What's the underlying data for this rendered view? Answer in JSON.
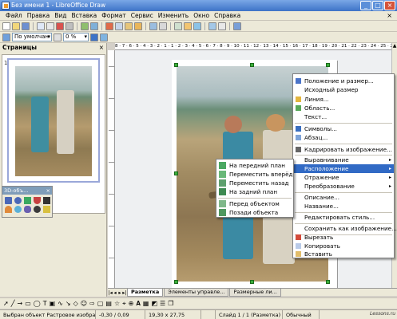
{
  "window": {
    "title": "Без имени 1 - LibreOffice Draw",
    "btn_min": "_",
    "btn_max": "□",
    "btn_close": "×"
  },
  "menu": [
    "Файл",
    "Правка",
    "Вид",
    "Вставка",
    "Формат",
    "Сервис",
    "Изменить",
    "Окно",
    "Справка"
  ],
  "menu_doc_close": "×",
  "toolbar2": {
    "line_style": "По умолчан",
    "line_width": "0 %"
  },
  "ruler_h": "8 · 7 · 6 · 5 · 4 · 3 · 2 · 1 · 1 · 2 · 3 · 4 · 5 · 6 · 7 · 8 · 9 · 10 · 11 · 12 · 13 · 14 · 15 · 16 · 17 · 18 · 19 · 20 · 21 · 22 · 23 · 24 · 25 · 26 · 27",
  "pages_panel": {
    "title": "Страницы",
    "close": "×",
    "page_number": "1"
  },
  "panel_3d": {
    "title": "3D-объ...",
    "close": "×"
  },
  "context_menu": {
    "items": [
      {
        "label": "Положение и размер...",
        "icon": "position-size-icon"
      },
      {
        "label": "Исходный размер",
        "icon": ""
      },
      {
        "label": "Линия...",
        "icon": "line-icon"
      },
      {
        "label": "Область...",
        "icon": "area-icon"
      },
      {
        "label": "Текст...",
        "icon": ""
      },
      {
        "label": "Символы...",
        "icon": "characters-icon"
      },
      {
        "label": "Абзац...",
        "icon": "paragraph-icon"
      },
      {
        "label": "Кадрировать изображение...",
        "icon": "crop-icon"
      },
      {
        "label": "Выравнивание",
        "icon": "",
        "submenu": "▸"
      },
      {
        "label": "Расположение",
        "icon": "",
        "submenu": "▸"
      },
      {
        "label": "Отражение",
        "icon": "",
        "submenu": "▸"
      },
      {
        "label": "Преобразование",
        "icon": "",
        "submenu": "▸"
      },
      {
        "label": "Описание...",
        "icon": ""
      },
      {
        "label": "Название...",
        "icon": ""
      },
      {
        "label": "Редактировать стиль...",
        "icon": ""
      },
      {
        "label": "Сохранить как изображение...",
        "icon": ""
      },
      {
        "label": "Вырезать",
        "icon": "cut-icon"
      },
      {
        "label": "Копировать",
        "icon": "copy-icon"
      },
      {
        "label": "Вставить",
        "icon": "paste-icon"
      }
    ]
  },
  "arrange_submenu": {
    "items": [
      {
        "label": "На передний план",
        "icon": "bring-to-front-icon"
      },
      {
        "label": "Переместить вперёд",
        "icon": "bring-forward-icon"
      },
      {
        "label": "Переместить назад",
        "icon": "send-backward-icon"
      },
      {
        "label": "На задний план",
        "icon": "send-to-back-icon"
      },
      {
        "label": "Перед объектом",
        "icon": "in-front-of-object-icon"
      },
      {
        "label": "Позади объекта",
        "icon": "behind-object-icon"
      }
    ]
  },
  "tabs": {
    "nav": [
      "|◂",
      "◂",
      "▸",
      "▸|"
    ],
    "items": [
      "Разметка",
      "Элементы управле...",
      "Размерные ли..."
    ]
  },
  "drawbar": {
    "text_tool": "T"
  },
  "statusbar": {
    "selection": "Выбран объект Растровое изображение",
    "position": "-0,30 / 0,09",
    "size": "19,30 x 27,75",
    "slide": "Слайд 1 / 1 (Разметка)",
    "style": "Обычный"
  },
  "watermark": "Lessons.ru",
  "colors": {
    "selection": "#316ac5",
    "handle": "#3aae3a",
    "titlebar": "#3d73c7"
  }
}
